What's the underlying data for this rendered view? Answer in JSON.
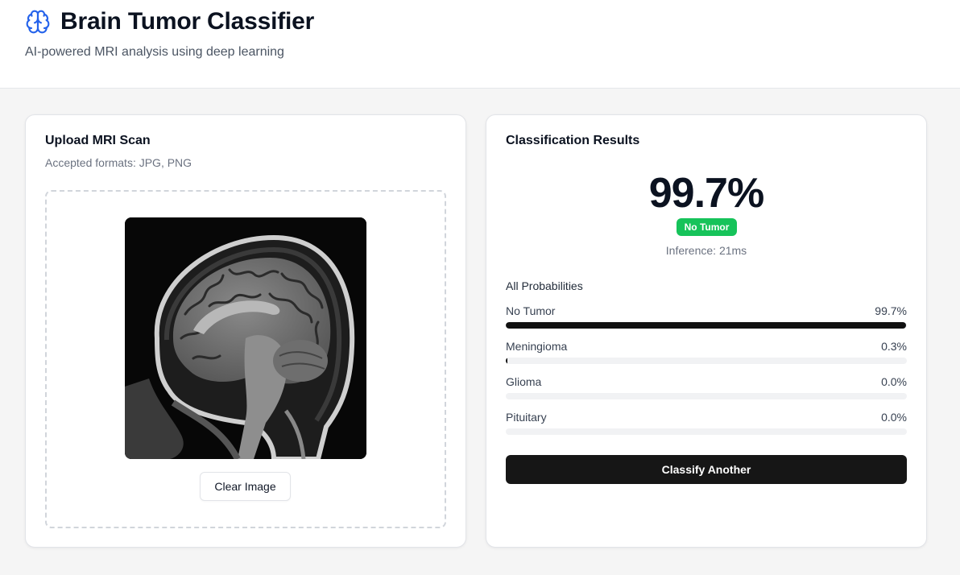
{
  "header": {
    "title": "Brain Tumor Classifier",
    "subtitle": "AI-powered MRI analysis using deep learning",
    "icon": "brain-icon",
    "accent_color": "#2563eb"
  },
  "upload": {
    "title": "Upload MRI Scan",
    "description": "Accepted formats: JPG, PNG",
    "clear_label": "Clear Image"
  },
  "results": {
    "title": "Classification Results",
    "top_confidence": "99.7%",
    "prediction_label": "No Tumor",
    "prediction_color": "#16c35a",
    "inference": "Inference: 21ms",
    "probabilities_title": "All Probabilities",
    "probabilities": [
      {
        "label": "No Tumor",
        "value": "99.7%",
        "fraction": 0.997
      },
      {
        "label": "Meningioma",
        "value": "0.3%",
        "fraction": 0.003
      },
      {
        "label": "Glioma",
        "value": "0.0%",
        "fraction": 0.0
      },
      {
        "label": "Pituitary",
        "value": "0.0%",
        "fraction": 0.0
      }
    ],
    "classify_label": "Classify Another"
  }
}
